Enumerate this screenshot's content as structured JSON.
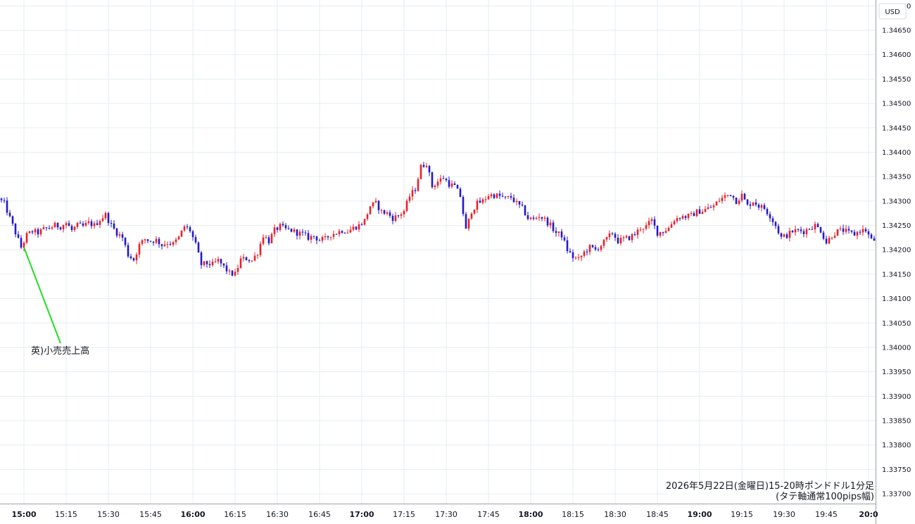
{
  "chart_data": {
    "type": "candlestick",
    "currency": "USD",
    "colors": {
      "up": "#e8202a",
      "down": "#2418c9",
      "grid": "#e6eef1",
      "annotation_line": "#22dd22"
    },
    "grid": true,
    "ylim": [
      1.3368,
      1.34712
    ],
    "y_ticks": [
      "1.34700",
      "1.34650",
      "1.34600",
      "1.34550",
      "1.34500",
      "1.34450",
      "1.34400",
      "1.34350",
      "1.34300",
      "1.34250",
      "1.34200",
      "1.34150",
      "1.34100",
      "1.34050",
      "1.34000",
      "1.33950",
      "1.33900",
      "1.33850",
      "1.33800",
      "1.33750",
      "1.33700"
    ],
    "x_ticks": [
      {
        "label": "15:00",
        "minute": 0,
        "major": true
      },
      {
        "label": "15:15",
        "minute": 15,
        "major": false
      },
      {
        "label": "15:30",
        "minute": 30,
        "major": false
      },
      {
        "label": "15:45",
        "minute": 45,
        "major": false
      },
      {
        "label": "16:00",
        "minute": 60,
        "major": true
      },
      {
        "label": "16:15",
        "minute": 75,
        "major": false
      },
      {
        "label": "16:30",
        "minute": 90,
        "major": false
      },
      {
        "label": "16:45",
        "minute": 105,
        "major": false
      },
      {
        "label": "17:00",
        "minute": 120,
        "major": true
      },
      {
        "label": "17:15",
        "minute": 135,
        "major": false
      },
      {
        "label": "17:30",
        "minute": 150,
        "major": false
      },
      {
        "label": "17:45",
        "minute": 165,
        "major": false
      },
      {
        "label": "18:00",
        "minute": 180,
        "major": true
      },
      {
        "label": "18:15",
        "minute": 195,
        "major": false
      },
      {
        "label": "18:30",
        "minute": 210,
        "major": false
      },
      {
        "label": "18:45",
        "minute": 225,
        "major": false
      },
      {
        "label": "19:00",
        "minute": 240,
        "major": true
      },
      {
        "label": "19:15",
        "minute": 255,
        "major": false
      },
      {
        "label": "19:30",
        "minute": 270,
        "major": false
      },
      {
        "label": "19:45",
        "minute": 285,
        "major": false
      },
      {
        "label": "20:0",
        "minute": 300,
        "major": true
      }
    ],
    "x_range_minutes": [
      -8,
      302
    ],
    "close_path": [
      [
        -8,
        1.34305
      ],
      [
        -6,
        1.34295
      ],
      [
        -4,
        1.34265
      ],
      [
        -2,
        1.34235
      ],
      [
        0,
        1.34205
      ],
      [
        2,
        1.3423
      ],
      [
        4,
        1.34238
      ],
      [
        6,
        1.34235
      ],
      [
        8,
        1.34242
      ],
      [
        10,
        1.34245
      ],
      [
        12,
        1.3425
      ],
      [
        14,
        1.34248
      ],
      [
        16,
        1.34255
      ],
      [
        18,
        1.3424
      ],
      [
        20,
        1.3425
      ],
      [
        22,
        1.34248
      ],
      [
        24,
        1.34255
      ],
      [
        26,
        1.3425
      ],
      [
        28,
        1.34262
      ],
      [
        30,
        1.34272
      ],
      [
        32,
        1.3425
      ],
      [
        34,
        1.34235
      ],
      [
        36,
        1.34225
      ],
      [
        38,
        1.3419
      ],
      [
        40,
        1.3418
      ],
      [
        42,
        1.3421
      ],
      [
        44,
        1.34222
      ],
      [
        46,
        1.34218
      ],
      [
        48,
        1.3422
      ],
      [
        50,
        1.3421
      ],
      [
        52,
        1.34215
      ],
      [
        54,
        1.34212
      ],
      [
        56,
        1.34225
      ],
      [
        58,
        1.34248
      ],
      [
        60,
        1.3424
      ],
      [
        62,
        1.3421
      ],
      [
        64,
        1.3417
      ],
      [
        66,
        1.34172
      ],
      [
        68,
        1.3417
      ],
      [
        70,
        1.34178
      ],
      [
        72,
        1.34165
      ],
      [
        74,
        1.34152
      ],
      [
        76,
        1.3415
      ],
      [
        78,
        1.3418
      ],
      [
        80,
        1.34182
      ],
      [
        82,
        1.34178
      ],
      [
        84,
        1.34195
      ],
      [
        86,
        1.3423
      ],
      [
        88,
        1.34218
      ],
      [
        90,
        1.3424
      ],
      [
        92,
        1.34248
      ],
      [
        94,
        1.34242
      ],
      [
        96,
        1.3424
      ],
      [
        98,
        1.34235
      ],
      [
        100,
        1.34232
      ],
      [
        102,
        1.34225
      ],
      [
        104,
        1.34228
      ],
      [
        106,
        1.3422
      ],
      [
        108,
        1.34222
      ],
      [
        110,
        1.34232
      ],
      [
        112,
        1.34235
      ],
      [
        114,
        1.3424
      ],
      [
        116,
        1.34238
      ],
      [
        118,
        1.34245
      ],
      [
        120,
        1.3425
      ],
      [
        122,
        1.3426
      ],
      [
        124,
        1.3429
      ],
      [
        126,
        1.34295
      ],
      [
        128,
        1.34278
      ],
      [
        130,
        1.34275
      ],
      [
        132,
        1.34265
      ],
      [
        134,
        1.3427
      ],
      [
        136,
        1.3428
      ],
      [
        138,
        1.3431
      ],
      [
        140,
        1.34325
      ],
      [
        142,
        1.3437
      ],
      [
        144,
        1.34378
      ],
      [
        146,
        1.3433
      ],
      [
        148,
        1.3434
      ],
      [
        150,
        1.34348
      ],
      [
        152,
        1.34335
      ],
      [
        154,
        1.3433
      ],
      [
        156,
        1.3431
      ],
      [
        158,
        1.3424
      ],
      [
        160,
        1.3428
      ],
      [
        162,
        1.34295
      ],
      [
        164,
        1.343
      ],
      [
        166,
        1.34312
      ],
      [
        168,
        1.34312
      ],
      [
        170,
        1.3431
      ],
      [
        172,
        1.34305
      ],
      [
        174,
        1.34308
      ],
      [
        176,
        1.34295
      ],
      [
        178,
        1.34285
      ],
      [
        180,
        1.34265
      ],
      [
        182,
        1.34262
      ],
      [
        184,
        1.3427
      ],
      [
        186,
        1.34262
      ],
      [
        188,
        1.3425
      ],
      [
        190,
        1.34235
      ],
      [
        192,
        1.3423
      ],
      [
        194,
        1.342
      ],
      [
        196,
        1.34185
      ],
      [
        198,
        1.3418
      ],
      [
        200,
        1.34195
      ],
      [
        202,
        1.34205
      ],
      [
        204,
        1.342
      ],
      [
        206,
        1.3421
      ],
      [
        208,
        1.34222
      ],
      [
        210,
        1.34235
      ],
      [
        212,
        1.34218
      ],
      [
        214,
        1.34222
      ],
      [
        216,
        1.34225
      ],
      [
        218,
        1.34232
      ],
      [
        220,
        1.34245
      ],
      [
        222,
        1.34248
      ],
      [
        224,
        1.3426
      ],
      [
        226,
        1.34235
      ],
      [
        228,
        1.34238
      ],
      [
        230,
        1.34245
      ],
      [
        232,
        1.34262
      ],
      [
        234,
        1.34268
      ],
      [
        236,
        1.34268
      ],
      [
        238,
        1.3427
      ],
      [
        240,
        1.34278
      ],
      [
        242,
        1.3428
      ],
      [
        244,
        1.34285
      ],
      [
        246,
        1.3429
      ],
      [
        248,
        1.34302
      ],
      [
        250,
        1.3431
      ],
      [
        252,
        1.34315
      ],
      [
        254,
        1.343
      ],
      [
        256,
        1.34312
      ],
      [
        258,
        1.3429
      ],
      [
        260,
        1.343
      ],
      [
        262,
        1.3429
      ],
      [
        264,
        1.34285
      ],
      [
        266,
        1.3427
      ],
      [
        268,
        1.3425
      ],
      [
        270,
        1.34225
      ],
      [
        272,
        1.3423
      ],
      [
        274,
        1.34238
      ],
      [
        276,
        1.3424
      ],
      [
        278,
        1.34238
      ],
      [
        280,
        1.34245
      ],
      [
        282,
        1.3425
      ],
      [
        284,
        1.3424
      ],
      [
        286,
        1.34215
      ],
      [
        288,
        1.3423
      ],
      [
        290,
        1.34238
      ],
      [
        292,
        1.3424
      ],
      [
        294,
        1.34235
      ],
      [
        296,
        1.34232
      ],
      [
        298,
        1.3424
      ],
      [
        300,
        1.3424
      ],
      [
        302,
        1.3422
      ]
    ],
    "annotations": [
      {
        "text": "英)小売売上高",
        "minute": 0,
        "price": 1.34205
      }
    ],
    "footer": [
      "2026年5月22日(金曜日)15-20時ポンドドル1分足",
      "(タテ軸通常100pips幅)"
    ]
  }
}
